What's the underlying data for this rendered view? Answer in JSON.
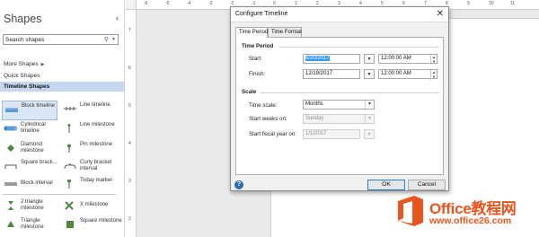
{
  "shapes_pane": {
    "title": "Shapes",
    "collapse_glyph": "‹",
    "search_placeholder": "Search shapes",
    "nav": {
      "more_shapes": "More Shapes",
      "quick_shapes": "Quick Shapes",
      "timeline_shapes": "Timeline Shapes"
    },
    "stencil": [
      {
        "label": "Block timeline",
        "icon": "block-timeline-icon"
      },
      {
        "label": "Line timeline",
        "icon": "line-timeline-icon"
      },
      {
        "label": "Cylindrical timeline",
        "icon": "cylindrical-timeline-icon"
      },
      {
        "label": "Line milestone",
        "icon": "line-milestone-icon"
      },
      {
        "label": "Diamond milestone",
        "icon": "diamond-milestone-icon"
      },
      {
        "label": "Pin milestone",
        "icon": "pin-milestone-icon"
      },
      {
        "label": "Square brack...",
        "icon": "square-bracket-icon"
      },
      {
        "label": "Curly bracket interval",
        "icon": "curly-bracket-icon"
      },
      {
        "label": "Block interval",
        "icon": "block-interval-icon"
      },
      {
        "label": "Today marker",
        "icon": "today-marker-icon"
      },
      {
        "label": "2 triangle milestone",
        "icon": "two-triangle-milestone-icon"
      },
      {
        "label": "X milestone",
        "icon": "x-milestone-icon"
      },
      {
        "label": "Triangle milestone",
        "icon": "triangle-milestone-icon"
      },
      {
        "label": "Square milestone",
        "icon": "square-milestone-icon"
      }
    ]
  },
  "ruler": {
    "top_ticks": [
      "-6",
      "-5",
      "-4",
      "-3",
      "-2",
      "-1",
      "0",
      "1",
      "2",
      "3",
      "4",
      "5",
      "6",
      "7",
      "8",
      "9",
      "10",
      "11"
    ],
    "left_ticks": [
      "7",
      "6",
      "5",
      "4",
      "3",
      "2"
    ]
  },
  "dialog": {
    "title": "Configure Timeline",
    "close_glyph": "✕",
    "tabs": [
      "Time Period",
      "Time Format"
    ],
    "time_period_group": "Time Period",
    "start_label": "Start:",
    "start_date": "6/20/2017",
    "start_time": "12:00:00 AM",
    "finish_label": "Finish:",
    "finish_date": "12/19/2017",
    "finish_time": "12:00:00 AM",
    "scale_group": "Scale",
    "timescale_label": "Time scale:",
    "timescale_value": "Months",
    "start_weeks_label": "Start weeks on:",
    "start_weeks_value": "Sunday",
    "fiscal_label": "Start fiscal year on:",
    "fiscal_value": "1/1/2017",
    "ok_label": "OK",
    "cancel_label": "Cancel",
    "help_glyph": "?"
  },
  "watermark": {
    "name": "Office教程网",
    "url": "www.office26.com"
  },
  "colors": {
    "selection": "#3399ff",
    "timeline_bar": "#5b9bd5",
    "milestone": "#e0a030",
    "watermark": "#e8561f"
  }
}
